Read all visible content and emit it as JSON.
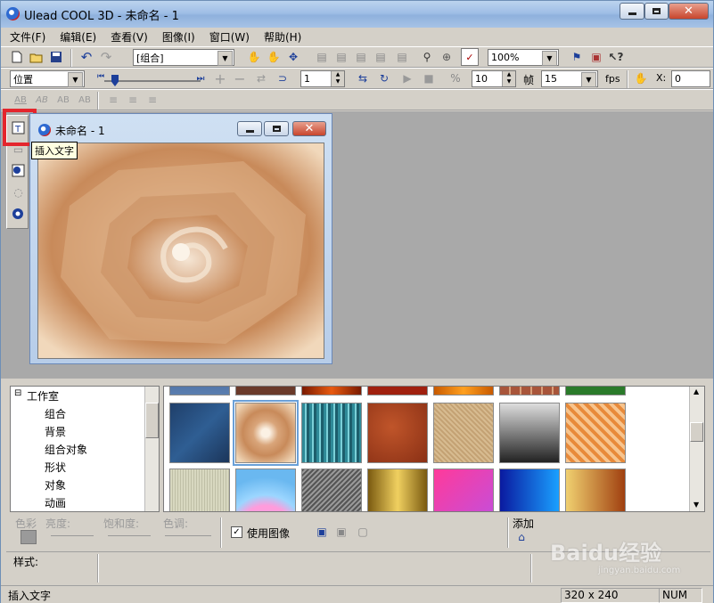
{
  "window": {
    "title": "Ulead COOL 3D - 未命名 - 1"
  },
  "menu": [
    "文件(F)",
    "编辑(E)",
    "查看(V)",
    "图像(I)",
    "窗口(W)",
    "帮助(H)"
  ],
  "toolbar1": {
    "group_combo": "[组合]",
    "zoom_combo": "100%"
  },
  "toolbar2": {
    "mode_combo": "位置",
    "frame_value": "1",
    "speed_value": "10",
    "frame_unit": "帧",
    "fps_value": "15",
    "fps_unit": "fps",
    "x_label": "X:",
    "x_value": "0"
  },
  "tooltip": "插入文字",
  "document": {
    "title": "未命名 - 1"
  },
  "tree": {
    "root": "工作室",
    "items": [
      "组合",
      "背景",
      "组合对象",
      "形状",
      "对象",
      "动画"
    ]
  },
  "props": {
    "color": "色彩",
    "brightness": "亮度:",
    "saturation": "饱和度:",
    "hue": "色调:",
    "use_image": "使用图像",
    "add": "添加",
    "style": "样式:"
  },
  "status": {
    "message": "插入文字",
    "size": "320 x 240",
    "num": "NUM"
  },
  "watermark": {
    "text": "Baidu经验",
    "sub": "jingyan.baidu.com"
  }
}
